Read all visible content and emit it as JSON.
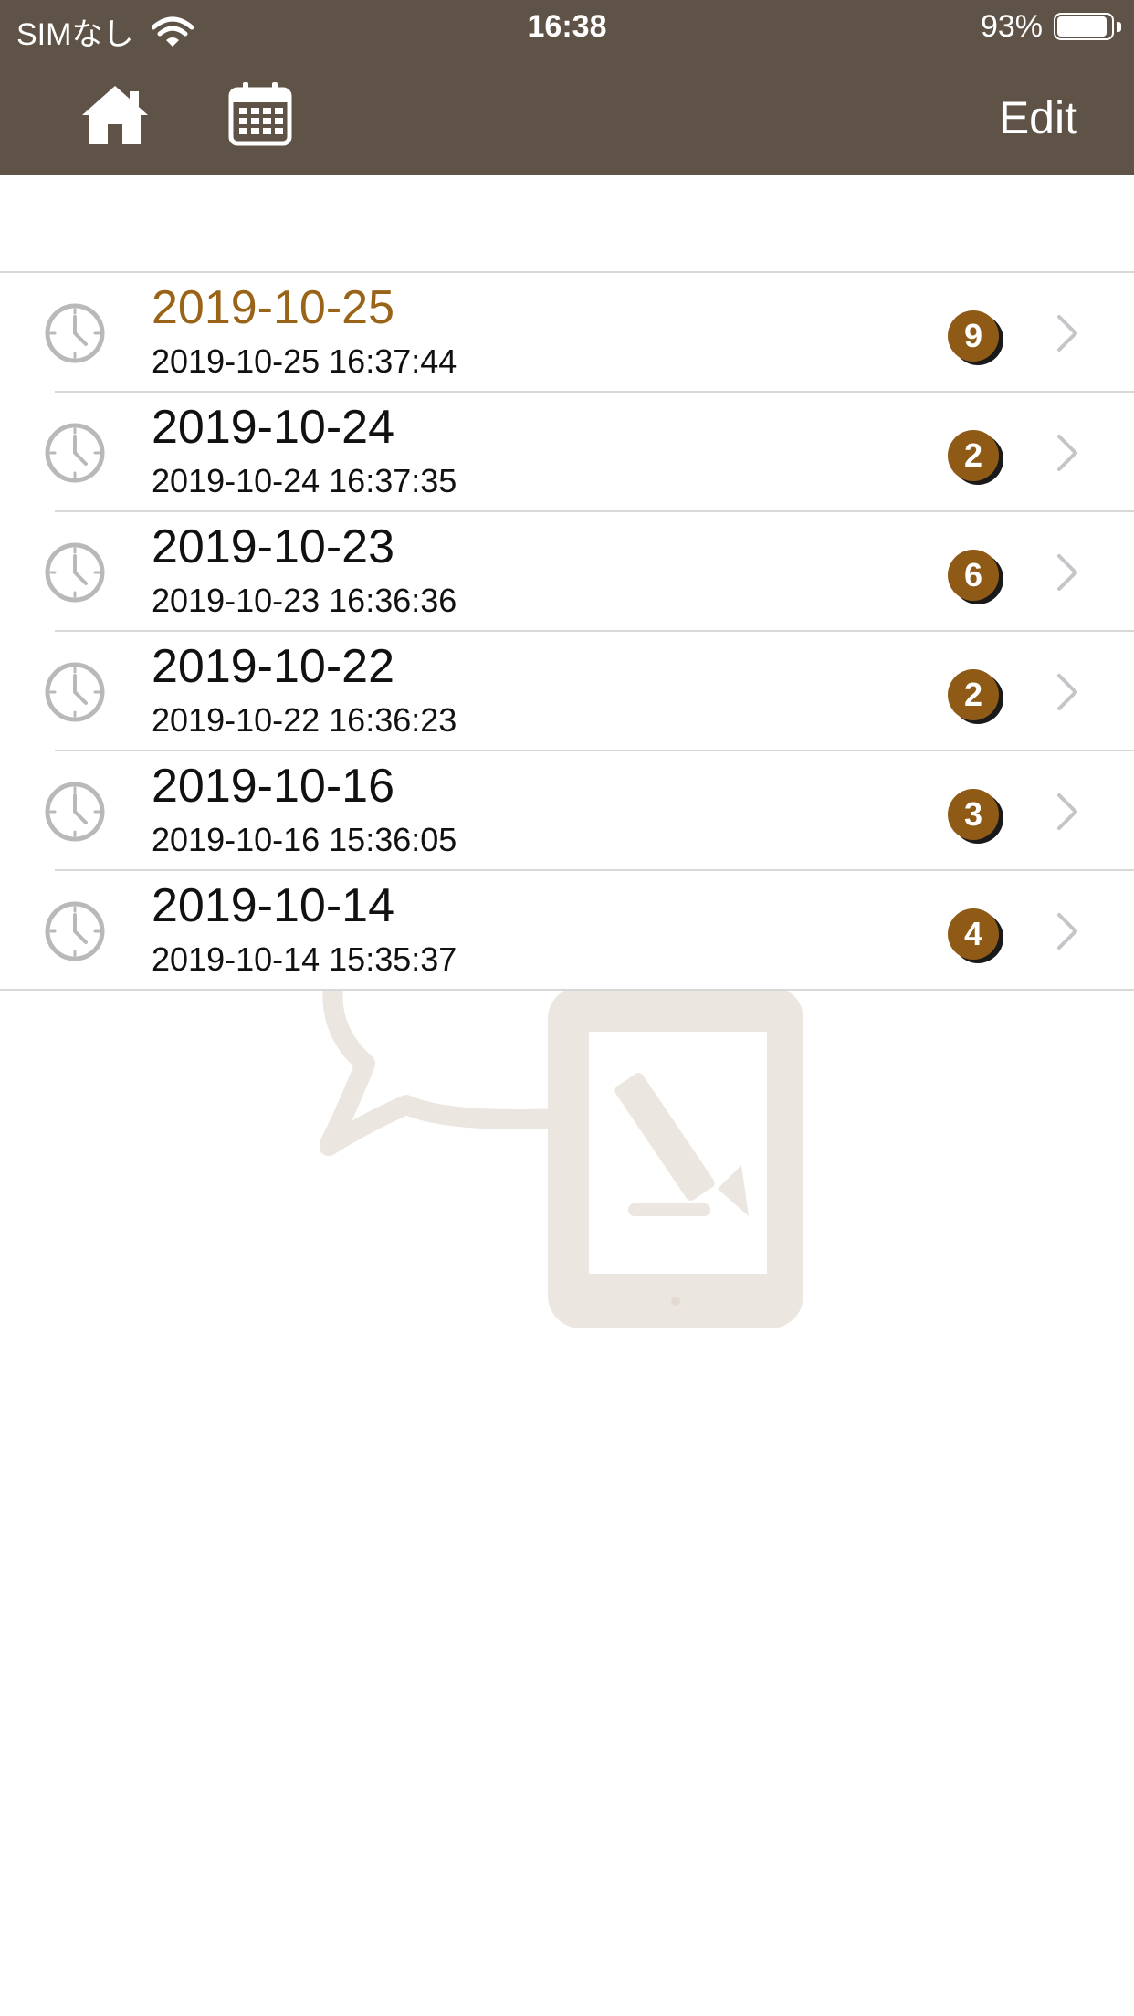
{
  "status_bar": {
    "carrier": "SIMなし",
    "time": "16:38",
    "battery_percent": "93%",
    "battery_level": 0.93
  },
  "nav": {
    "left_icons": [
      "home-icon",
      "calendar-icon"
    ],
    "edit_label": "Edit"
  },
  "colors": {
    "nav_background": "#5e5346",
    "active_title": "#9a6418",
    "badge": "#8f5a16",
    "separator": "#d8d8d8",
    "watermark": "#ece6e1"
  },
  "entries": [
    {
      "title": "2019-10-25",
      "subtitle": "2019-10-25 16:37:44",
      "count": "9",
      "active": true
    },
    {
      "title": "2019-10-24",
      "subtitle": "2019-10-24 16:37:35",
      "count": "2",
      "active": false
    },
    {
      "title": "2019-10-23",
      "subtitle": "2019-10-23 16:36:36",
      "count": "6",
      "active": false
    },
    {
      "title": "2019-10-22",
      "subtitle": "2019-10-22 16:36:23",
      "count": "2",
      "active": false
    },
    {
      "title": "2019-10-16",
      "subtitle": "2019-10-16 15:36:05",
      "count": "3",
      "active": false
    },
    {
      "title": "2019-10-14",
      "subtitle": "2019-10-14 15:35:37",
      "count": "4",
      "active": false
    }
  ]
}
